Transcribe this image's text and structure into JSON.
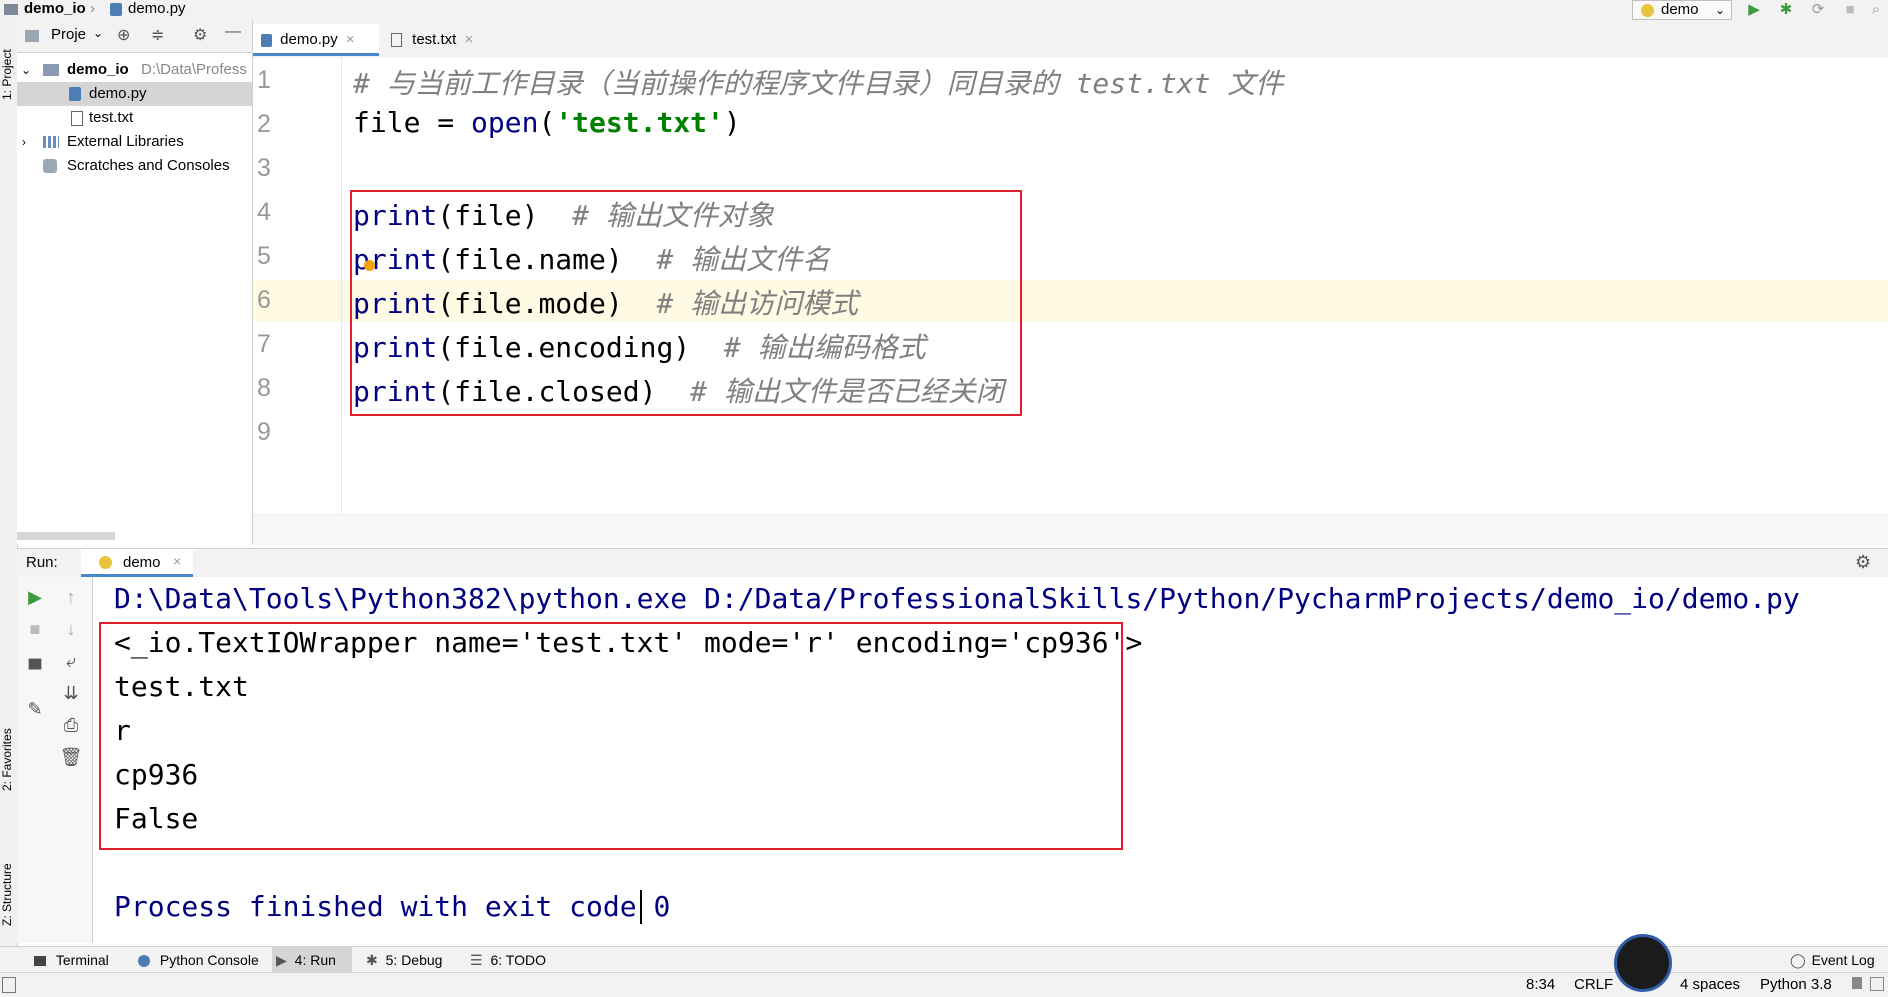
{
  "titlebar": {
    "project": "demo_io",
    "file": "demo.py",
    "run_config": "demo"
  },
  "project_panel": {
    "title": "Proje",
    "root_name": "demo_io",
    "root_path": "D:\\Data\\Profess",
    "files": [
      "demo.py",
      "test.txt"
    ],
    "external_libraries": "External Libraries",
    "scratches": "Scratches and Consoles"
  },
  "side_labels": {
    "project": "1: Project",
    "favorites": "2: Favorites",
    "structure": "Z: Structure"
  },
  "editor": {
    "tabs": [
      "demo.py",
      "test.txt"
    ],
    "line_numbers": [
      "1",
      "2",
      "3",
      "4",
      "5",
      "6",
      "7",
      "8",
      "9"
    ],
    "lines": {
      "l1": "# 与当前工作目录（当前操作的程序文件目录）同目录的 test.txt 文件",
      "l2_a": "file = ",
      "l2_kw": "open",
      "l2_p1": "(",
      "l2_str": "'test.txt'",
      "l2_p2": ")",
      "l4_kw": "print",
      "l4_code": "(file)  ",
      "l4_cmt": "# 输出文件对象",
      "l5_kw": "print",
      "l5_code": "(file.name)  ",
      "l5_cmt": "# 输出文件名",
      "l6_kw": "print",
      "l6_code": "(file.mode)  ",
      "l6_cmt": "# 输出访问模式",
      "l7_kw": "print",
      "l7_code": "(file.encoding)  ",
      "l7_cmt": "# 输出编码格式",
      "l8_kw": "print",
      "l8_code": "(file.closed)  ",
      "l8_cmt": "# 输出文件是否已经关闭"
    }
  },
  "run_panel": {
    "label": "Run:",
    "tab": "demo",
    "command": "D:\\Data\\Tools\\Python382\\python.exe D:/Data/ProfessionalSkills/Python/PycharmProjects/demo_io/demo.py",
    "output": [
      "<_io.TextIOWrapper name='test.txt' mode='r' encoding='cp936'>",
      "test.txt",
      "r",
      "cp936",
      "False"
    ],
    "finished": "Process finished with exit code 0"
  },
  "bottom_tabs": {
    "terminal": "Terminal",
    "python_console": "Python Console",
    "run": "4: Run",
    "debug": "5: Debug",
    "todo": "6: TODO",
    "event_log": "Event Log"
  },
  "status": {
    "position": "8:34",
    "line_sep": "CRLF",
    "indent": "4 spaces",
    "interpreter": "Python 3.8"
  },
  "colors": {
    "keyword": "#000080",
    "string": "#008000",
    "comment": "#808080",
    "highlight_box": "#e0202a",
    "current_line": "#fffae3"
  }
}
